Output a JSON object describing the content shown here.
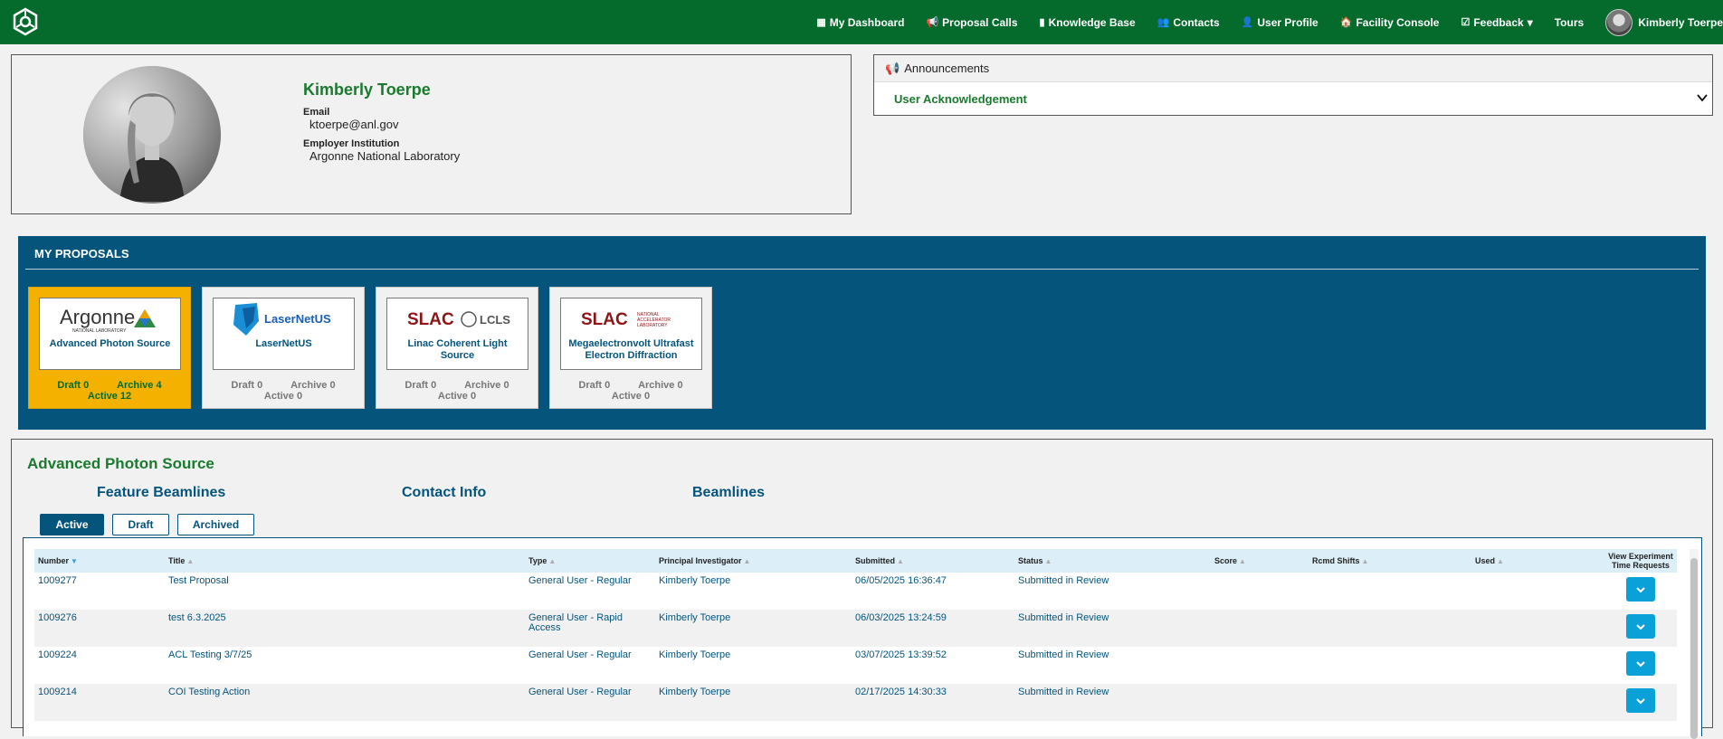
{
  "nav": {
    "links": [
      {
        "icon": "table-icon",
        "glyph": "▦",
        "label": "My Dashboard"
      },
      {
        "icon": "bullhorn-icon",
        "glyph": "📢",
        "label": "Proposal Calls"
      },
      {
        "icon": "book-icon",
        "glyph": "▮",
        "label": "Knowledge Base"
      },
      {
        "icon": "users-icon",
        "glyph": "👥",
        "label": "Contacts"
      },
      {
        "icon": "user-icon",
        "glyph": "👤",
        "label": "User Profile"
      },
      {
        "icon": "home-icon",
        "glyph": "🏠",
        "label": "Facility Console"
      },
      {
        "icon": "check-square-icon",
        "glyph": "☑",
        "label": "Feedback"
      },
      {
        "icon": "",
        "glyph": "",
        "label": "Tours"
      }
    ],
    "user_name": "Kimberly Toerpe"
  },
  "profile": {
    "name": "Kimberly Toerpe",
    "email_label": "Email",
    "email": "ktoerpe@anl.gov",
    "institution_label": "Employer Institution",
    "institution": "Argonne National Laboratory"
  },
  "announcements": {
    "title": "Announcements",
    "item": "User Acknowledgement"
  },
  "my_proposals": {
    "title": "MY PROPOSALS",
    "facilities": [
      {
        "name": "Advanced Photon Source",
        "logo_text": "Argonne",
        "logo_sub": "NATIONAL LABORATORY",
        "draft": "Draft 0",
        "archive": "Archive 4",
        "active": "Active 12",
        "selected": true
      },
      {
        "name": "LaserNetUS",
        "logo_text": "LaserNetUS",
        "logo_sub": "",
        "draft": "Draft 0",
        "archive": "Archive 0",
        "active": "Active 0",
        "selected": false
      },
      {
        "name": "Linac Coherent Light Source",
        "logo_text": "SLAC",
        "logo_sub": "LCLS",
        "draft": "Draft 0",
        "archive": "Archive 0",
        "active": "Active 0",
        "selected": false
      },
      {
        "name": "Megaelectronvolt Ultrafast Electron Diffraction",
        "logo_text": "SLAC",
        "logo_sub": "NATIONAL ACCELERATOR LABORATORY",
        "draft": "Draft 0",
        "archive": "Archive 0",
        "active": "Active 0",
        "selected": false
      }
    ]
  },
  "detail": {
    "title": "Advanced Photon Source",
    "links": [
      "Feature Beamlines",
      "Contact Info",
      "Beamlines"
    ],
    "tabs": [
      "Active",
      "Draft",
      "Archived"
    ],
    "columns": [
      "Number",
      "Title",
      "Type",
      "Principal Investigator",
      "Submitted",
      "Status",
      "Score",
      "Rcmd Shifts",
      "Used",
      "View Experiment Time Requests"
    ],
    "rows": [
      {
        "number": "1009277",
        "title": "Test Proposal",
        "type": "General User - Regular",
        "pi": "Kimberly Toerpe",
        "submitted": "06/05/2025 16:36:47",
        "status": "Submitted in Review"
      },
      {
        "number": "1009276",
        "title": "test 6.3.2025",
        "type": "General User - Rapid Access",
        "pi": "Kimberly Toerpe",
        "submitted": "06/03/2025 13:24:59",
        "status": "Submitted in Review"
      },
      {
        "number": "1009224",
        "title": "ACL Testing 3/7/25",
        "type": "General User - Regular",
        "pi": "Kimberly Toerpe",
        "submitted": "03/07/2025 13:39:52",
        "status": "Submitted in Review"
      },
      {
        "number": "1009214",
        "title": "COI Testing Action",
        "type": "General User - Regular",
        "pi": "Kimberly Toerpe",
        "submitted": "02/17/2025 14:30:33",
        "status": "Submitted in Review"
      }
    ]
  },
  "colors": {
    "nav": "#046b2c",
    "panel": "#04547c",
    "selected": "#f5b100",
    "accent": "#0aa0d8"
  }
}
